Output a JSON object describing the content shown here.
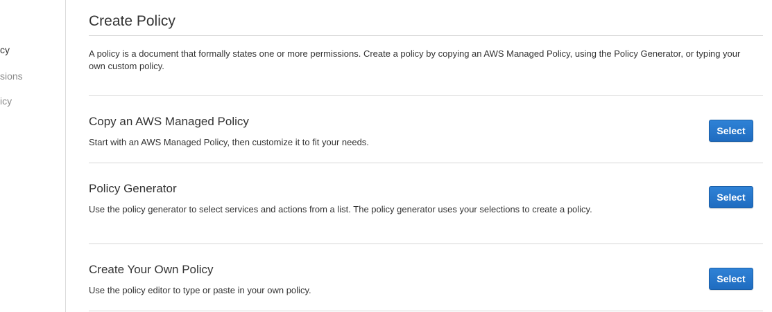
{
  "sidebar": {
    "items": [
      {
        "label": "cy"
      },
      {
        "label": "sions"
      },
      {
        "label": "icy"
      }
    ]
  },
  "main": {
    "title": "Create Policy",
    "intro": "A policy is a document that formally states one or more permissions. Create a policy by copying an AWS Managed Policy, using the Policy Generator, or typing your own custom policy.",
    "options": [
      {
        "title": "Copy an AWS Managed Policy",
        "description": "Start with an AWS Managed Policy, then customize it to fit your needs.",
        "button_label": "Select"
      },
      {
        "title": "Policy Generator",
        "description": "Use the policy generator to select services and actions from a list. The policy generator uses your selections to create a policy.",
        "button_label": "Select"
      },
      {
        "title": "Create Your Own Policy",
        "description": "Use the policy editor to type or paste in your own policy.",
        "button_label": "Select"
      }
    ]
  },
  "colors": {
    "button_bg": "#2176cc",
    "button_text": "#ffffff",
    "divider": "#d6d6d6",
    "text": "#333333",
    "sidebar_muted": "#8a8a8a"
  }
}
